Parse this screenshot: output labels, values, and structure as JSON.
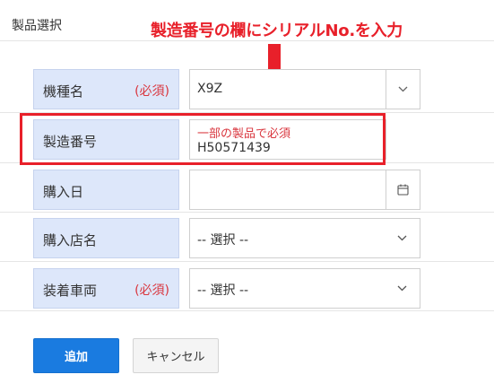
{
  "section": {
    "title": "製品選択"
  },
  "annotation": {
    "text": "製造番号の欄にシリアルNo.を入力",
    "color": "#e8202a"
  },
  "form": {
    "model": {
      "label": "機種名",
      "required": "(必須)",
      "value": "X9Z",
      "icon": "chevron-down-icon"
    },
    "serial": {
      "label": "製造番号",
      "hint": "一部の製品で必須",
      "value": "H50571439"
    },
    "purchase_date": {
      "label": "購入日",
      "value": "",
      "icon": "calendar-icon"
    },
    "store": {
      "label": "購入店名",
      "value": "-- 選択 --",
      "icon": "chevron-down-icon"
    },
    "vehicle": {
      "label": "装着車両",
      "required": "(必須)",
      "value": "-- 選択 --",
      "icon": "chevron-down-icon"
    }
  },
  "buttons": {
    "add": "追加",
    "cancel": "キャンセル"
  },
  "colors": {
    "label_bg": "#dde7fa",
    "required": "#d9363e",
    "primary": "#1a7be0"
  }
}
